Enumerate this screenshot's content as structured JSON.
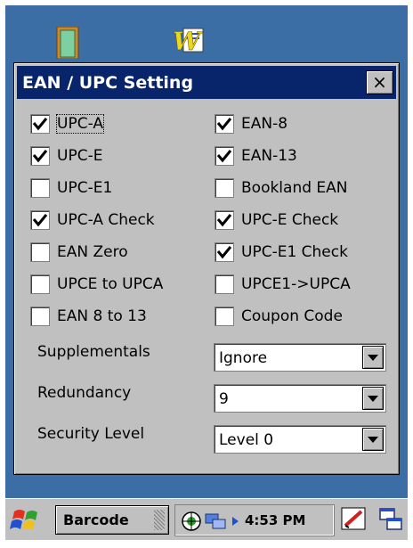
{
  "dialog": {
    "title": "EAN / UPC Setting",
    "close_label": "×"
  },
  "checkboxes_left": [
    {
      "label": "UPC-A",
      "checked": true
    },
    {
      "label": "UPC-E",
      "checked": true
    },
    {
      "label": "UPC-E1",
      "checked": false
    },
    {
      "label": "UPC-A Check",
      "checked": true
    },
    {
      "label": "EAN Zero",
      "checked": false
    },
    {
      "label": "UPCE to UPCA",
      "checked": false
    },
    {
      "label": "EAN 8 to 13",
      "checked": false
    }
  ],
  "checkboxes_right": [
    {
      "label": "EAN-8",
      "checked": true
    },
    {
      "label": "EAN-13",
      "checked": true
    },
    {
      "label": "Bookland EAN",
      "checked": false
    },
    {
      "label": "UPC-E Check",
      "checked": true
    },
    {
      "label": "UPC-E1 Check",
      "checked": true
    },
    {
      "label": "UPCE1->UPCA",
      "checked": false
    },
    {
      "label": "Coupon Code",
      "checked": false
    }
  ],
  "dropdowns": [
    {
      "label": "Supplementals",
      "value": "Ignore"
    },
    {
      "label": "Redundancy",
      "value": "9"
    },
    {
      "label": "Security Level",
      "value": "Level 0"
    }
  ],
  "taskbar": {
    "task_label": "Barcode",
    "clock": "4:53 PM"
  },
  "colors": {
    "desktop": "#3a6ea5",
    "title_bar": "#08246b",
    "face": "#c0c0c0"
  },
  "icons": [
    "document-icon",
    "word-icon",
    "windows-flag-icon",
    "network-icon",
    "arrow-right-icon",
    "pen-input-icon",
    "switch-windows-icon"
  ]
}
